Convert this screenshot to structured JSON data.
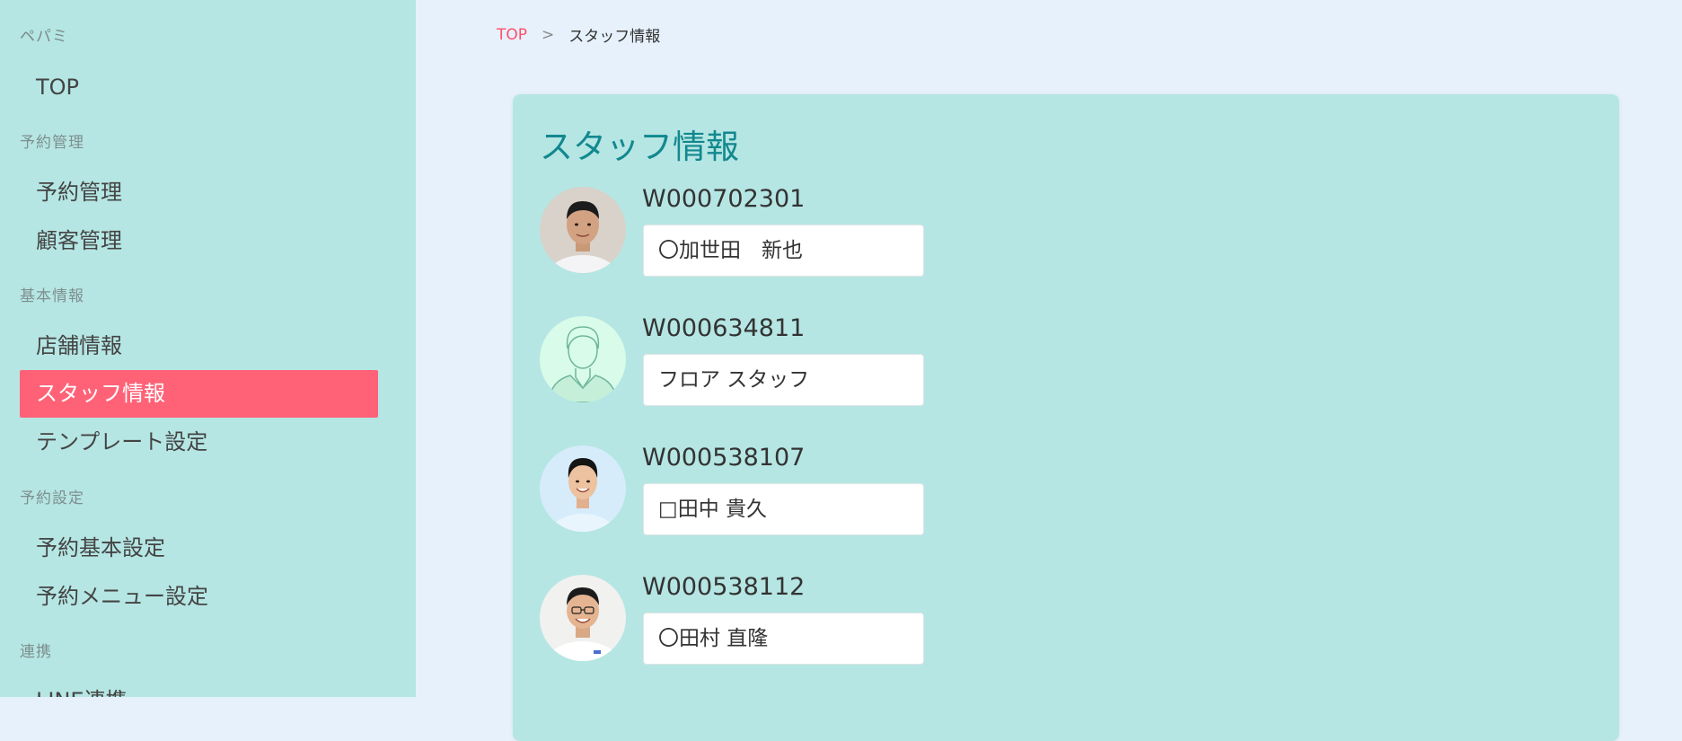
{
  "sidebar": {
    "brand": "ペパミ",
    "sections": [
      {
        "label": "予約管理"
      },
      {
        "label": "基本情報"
      },
      {
        "label": "予約設定"
      },
      {
        "label": "連携"
      }
    ],
    "items": [
      {
        "label": "TOP"
      },
      {
        "label": "予約管理"
      },
      {
        "label": "顧客管理"
      },
      {
        "label": "店舗情報"
      },
      {
        "label": "スタッフ情報",
        "active": true
      },
      {
        "label": "テンプレート設定"
      },
      {
        "label": "予約基本設定"
      },
      {
        "label": "予約メニュー設定"
      },
      {
        "label": "LINE連携"
      }
    ]
  },
  "breadcrumb": {
    "home": "TOP",
    "separator": ">",
    "current": "スタッフ情報"
  },
  "main": {
    "title": "スタッフ情報",
    "staff": [
      {
        "id": "W000702301",
        "name": "〇加世田　新也",
        "avatar": "staff-photo"
      },
      {
        "id": "W000634811",
        "name": "フロア スタッフ",
        "avatar": "placeholder-person-icon"
      },
      {
        "id": "W000538107",
        "name": "□田中 貴久",
        "avatar": "staff-photo"
      },
      {
        "id": "W000538112",
        "name": "〇田村 直隆",
        "avatar": "staff-photo"
      }
    ]
  },
  "colors": {
    "sidebar_bg": "#b5e6e3",
    "page_bg": "#e6f1fc",
    "accent": "#ff6277",
    "title": "#12888f"
  }
}
